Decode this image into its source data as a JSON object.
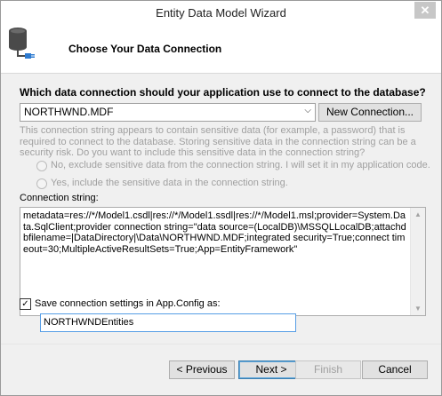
{
  "window": {
    "title": "Entity Data Model Wizard",
    "close_glyph": "✕"
  },
  "header": {
    "icon": "database-connection-icon",
    "title": "Choose Your Data Connection"
  },
  "connection": {
    "question": "Which data connection should your application use to connect to the database?",
    "selected": "NORTHWND.MDF",
    "new_connection_label": "New Connection..."
  },
  "sensitive": {
    "info": "This connection string appears to contain sensitive data (for example, a password) that is required to connect to the database. Storing sensitive data in the connection string can be a security risk. Do you want to include this sensitive data in the connection string?",
    "option_no": "No, exclude sensitive data from the connection string. I will set it in my application code.",
    "option_yes": "Yes, include the sensitive data in the connection string."
  },
  "connection_string": {
    "label": "Connection string:",
    "value": "metadata=res://*/Model1.csdl|res://*/Model1.ssdl|res://*/Model1.msl;provider=System.Data.SqlClient;provider connection string=\"data source=(LocalDB)\\MSSQLLocalDB;attachdbfilename=|DataDirectory|\\Data\\NORTHWND.MDF;integrated security=True;connect timeout=30;MultipleActiveResultSets=True;App=EntityFramework\""
  },
  "save_settings": {
    "checked": true,
    "label": "Save connection settings in App.Config as:",
    "value": "NORTHWNDEntities"
  },
  "buttons": {
    "previous": "< Previous",
    "next": "Next >",
    "finish": "Finish",
    "cancel": "Cancel"
  }
}
